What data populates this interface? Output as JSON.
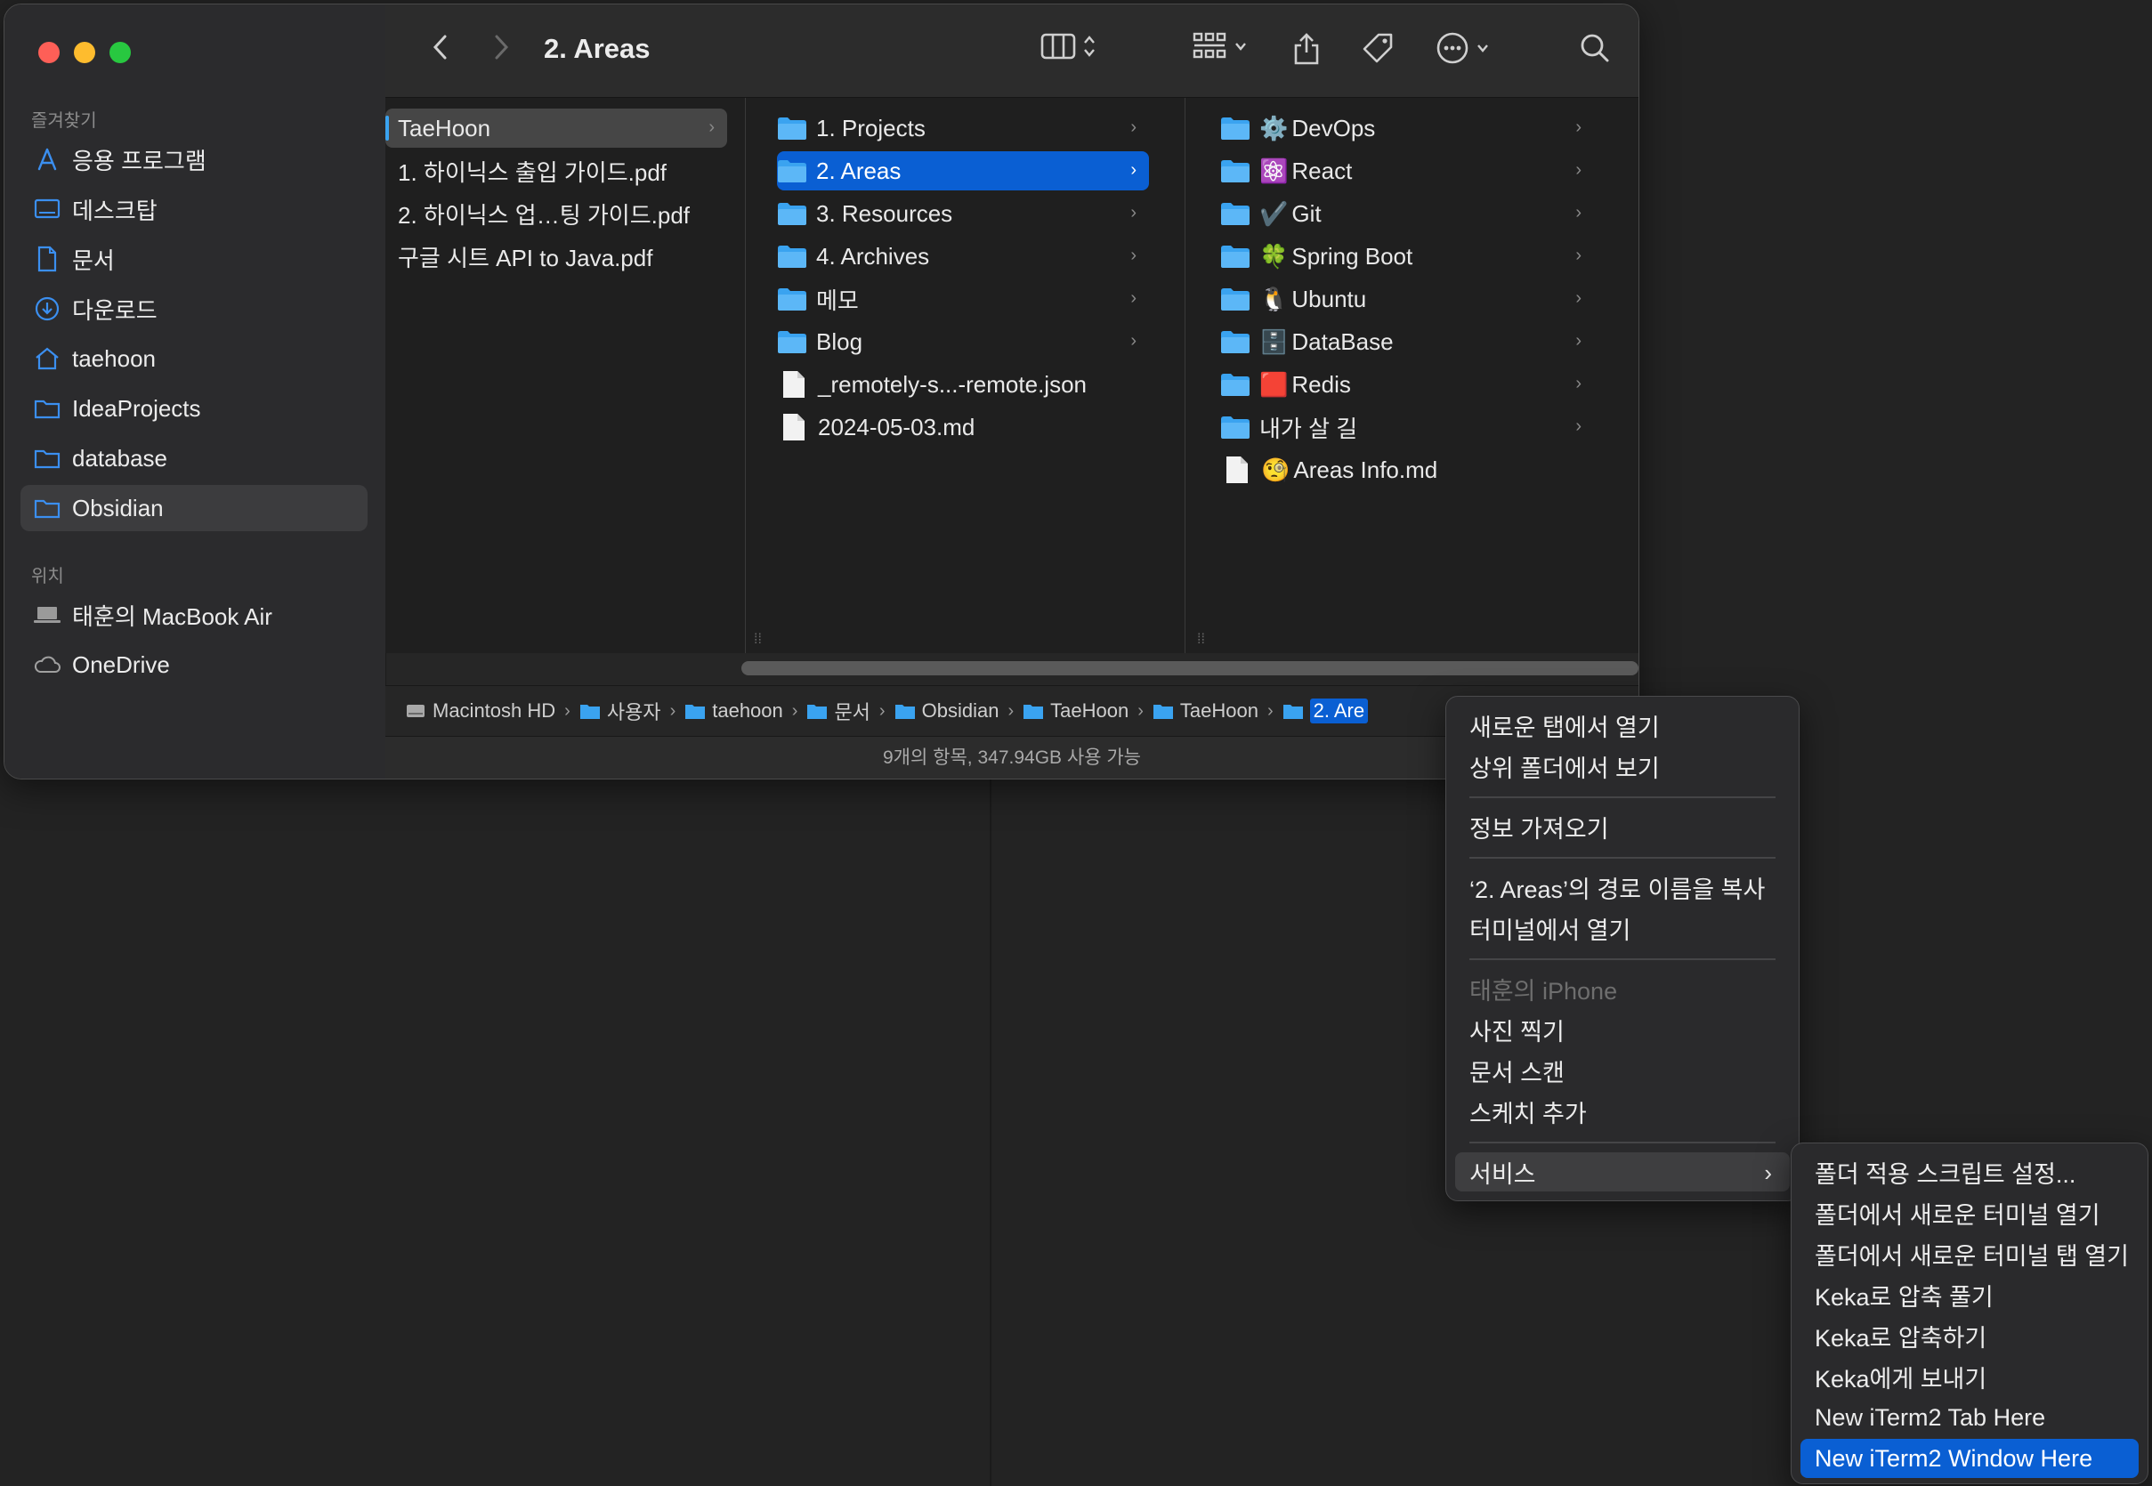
{
  "window_title": "2. Areas",
  "sidebar": {
    "favorites_header": "즐겨찾기",
    "favorites": [
      {
        "label": "응용 프로그램",
        "icon": "apps-icon"
      },
      {
        "label": "데스크탑",
        "icon": "desktop-icon"
      },
      {
        "label": "문서",
        "icon": "document-icon"
      },
      {
        "label": "다운로드",
        "icon": "download-icon"
      },
      {
        "label": "taehoon",
        "icon": "home-icon"
      },
      {
        "label": "IdeaProjects",
        "icon": "folder-icon"
      },
      {
        "label": "database",
        "icon": "folder-icon"
      },
      {
        "label": "Obsidian",
        "icon": "folder-icon",
        "selected": true
      }
    ],
    "locations_header": "위치",
    "locations": [
      {
        "label": "태훈의 MacBook Air",
        "icon": "laptop-icon"
      },
      {
        "label": "OneDrive",
        "icon": "cloud-icon"
      }
    ]
  },
  "columns": {
    "col1": [
      {
        "label": "TaeHoon",
        "type": "folder",
        "selected": true
      },
      {
        "label": "1. 하이닉스 출입 가이드.pdf",
        "type": "file"
      },
      {
        "label": "2. 하이닉스 업…팅 가이드.pdf",
        "type": "file"
      },
      {
        "label": "구글 시트 API to Java.pdf",
        "type": "file"
      }
    ],
    "col2": [
      {
        "label": "1. Projects",
        "type": "folder"
      },
      {
        "label": "2. Areas",
        "type": "folder",
        "selected": true
      },
      {
        "label": "3. Resources",
        "type": "folder"
      },
      {
        "label": "4. Archives",
        "type": "folder"
      },
      {
        "label": "메모",
        "type": "folder"
      },
      {
        "label": "Blog",
        "type": "folder"
      },
      {
        "label": "_remotely-s...-remote.json",
        "type": "file"
      },
      {
        "label": "2024-05-03.md",
        "type": "file"
      }
    ],
    "col3": [
      {
        "emoji": "⚙️",
        "label": "DevOps",
        "type": "folder"
      },
      {
        "emoji": "⚛️",
        "label": "React",
        "type": "folder"
      },
      {
        "emoji": "✔️",
        "label": "Git",
        "type": "folder"
      },
      {
        "emoji": "🍀",
        "label": "Spring Boot",
        "type": "folder"
      },
      {
        "emoji": "🐧",
        "label": "Ubuntu",
        "type": "folder"
      },
      {
        "emoji": "🗄️",
        "label": "DataBase",
        "type": "folder"
      },
      {
        "emoji": "🟥",
        "label": "Redis",
        "type": "folder"
      },
      {
        "emoji": "",
        "label": "내가 살 길",
        "type": "folder"
      },
      {
        "emoji": "🧐",
        "label": "Areas Info.md",
        "type": "file"
      }
    ]
  },
  "pathbar": [
    "Macintosh HD",
    "사용자",
    "taehoon",
    "문서",
    "Obsidian",
    "TaeHoon",
    "TaeHoon",
    "2. Are"
  ],
  "status": "9개의 항목, 347.94GB 사용 가능",
  "context_menu": {
    "items": [
      "새로운 탭에서 열기",
      "상위 폴더에서 보기",
      "정보 가져오기",
      "‘2. Areas’의 경로 이름을 복사",
      "터미널에서 열기",
      "태훈의 iPhone",
      "사진 찍기",
      "문서 스캔",
      "스케치 추가",
      "서비스"
    ]
  },
  "services_menu": {
    "items": [
      "폴더 적용 스크립트 설정...",
      "폴더에서 새로운 터미널 열기",
      "폴더에서 새로운 터미널 탭 열기",
      "Keka로 압축 풀기",
      "Keka로 압축하기",
      "Keka에게 보내기",
      "New iTerm2 Tab Here",
      "New iTerm2 Window Here"
    ]
  },
  "colors": {
    "accent": "#0a5fd3",
    "folder": "#3aa3f0",
    "close": "#fe5f57",
    "minimize": "#febc2e",
    "zoom": "#28c840"
  }
}
